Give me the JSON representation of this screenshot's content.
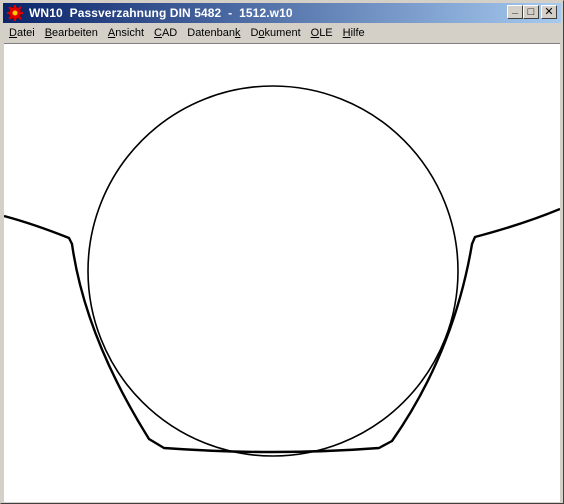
{
  "window": {
    "title": "WN10  Passverzahnung DIN 5482  -  1512.w10",
    "app_icon": "red-gear-app-icon",
    "controls": {
      "minimize": "_",
      "maximize": "□",
      "close": "✕"
    }
  },
  "menu": {
    "items": [
      {
        "pre": "",
        "ul": "D",
        "post": "atei"
      },
      {
        "pre": "",
        "ul": "B",
        "post": "earbeiten"
      },
      {
        "pre": "",
        "ul": "A",
        "post": "nsicht"
      },
      {
        "pre": "",
        "ul": "C",
        "post": "AD"
      },
      {
        "pre": "Datenban",
        "ul": "k",
        "post": ""
      },
      {
        "pre": "D",
        "ul": "o",
        "post": "kument"
      },
      {
        "pre": "",
        "ul": "O",
        "post": "LE"
      },
      {
        "pre": "",
        "ul": "H",
        "post": "ilfe"
      }
    ]
  },
  "drawing": {
    "stroke_color": "#000000",
    "background": "#ffffff"
  }
}
